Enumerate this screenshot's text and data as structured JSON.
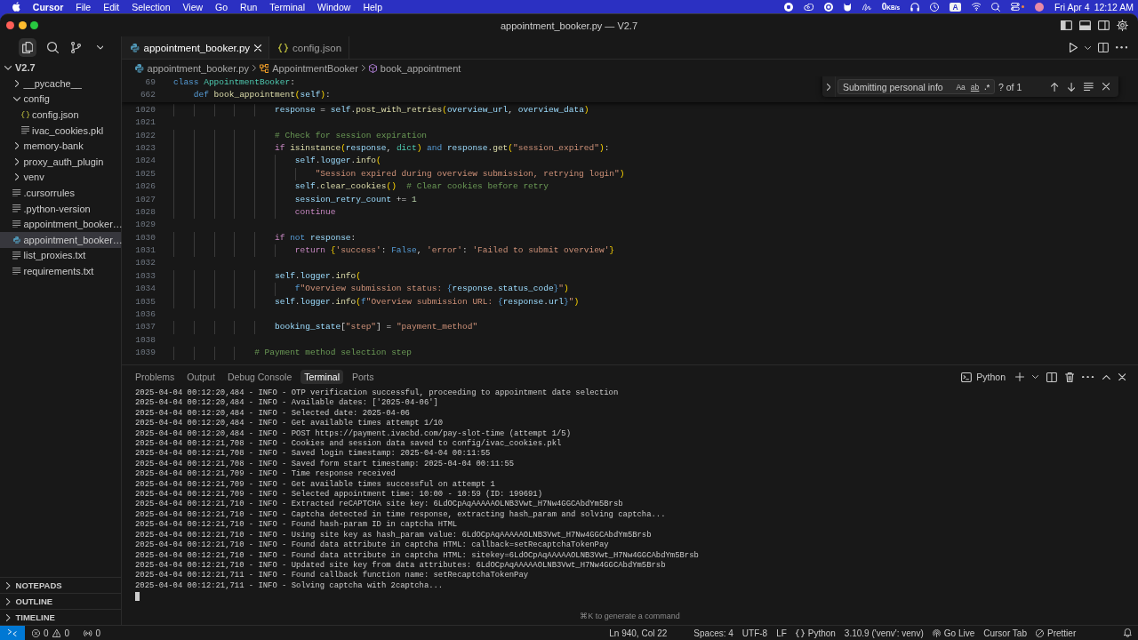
{
  "menu_bar": {
    "app": "Cursor",
    "menus": [
      "File",
      "Edit",
      "Selection",
      "View",
      "Go",
      "Run",
      "Terminal",
      "Window",
      "Help"
    ],
    "network": {
      "value": "0",
      "unit": "KB/s"
    },
    "input_source": "A",
    "date": "Fri Apr 4",
    "time": "12:12 AM"
  },
  "window": {
    "title": "appointment_booker.py — V2.7"
  },
  "activity_bar": [
    {
      "selected": true
    },
    {
      "selected": false
    },
    {
      "selected": false
    }
  ],
  "explorer": {
    "root": {
      "label": "V2.7",
      "kind": "folder",
      "expanded": true,
      "selected": false,
      "children": [
        {
          "label": "__pycache__",
          "kind": "folder",
          "expanded": false,
          "selected": false
        },
        {
          "label": "config",
          "kind": "folder",
          "expanded": true,
          "selected": false,
          "children": [
            {
              "label": "config.json",
              "kind": "json",
              "selected": false
            },
            {
              "label": "ivac_cookies.pkl",
              "kind": "text",
              "selected": false
            }
          ]
        },
        {
          "label": "memory-bank",
          "kind": "folder",
          "expanded": false,
          "selected": false
        },
        {
          "label": "proxy_auth_plugin",
          "kind": "folder",
          "expanded": false,
          "selected": false
        },
        {
          "label": "venv",
          "kind": "folder",
          "expanded": false,
          "selected": false
        },
        {
          "label": ".cursorrules",
          "kind": "text",
          "selected": false
        },
        {
          "label": ".python-version",
          "kind": "text",
          "selected": false
        },
        {
          "label": "appointment_booker…",
          "kind": "text",
          "selected": false
        },
        {
          "label": "appointment_booker…",
          "kind": "python",
          "selected": true
        },
        {
          "label": "list_proxies.txt",
          "kind": "text",
          "selected": false
        },
        {
          "label": "requirements.txt",
          "kind": "text",
          "selected": false
        }
      ]
    }
  },
  "sections": [
    {
      "label": "NOTEPADS",
      "expanded": false
    },
    {
      "label": "OUTLINE",
      "expanded": false
    },
    {
      "label": "TIMELINE",
      "expanded": false
    }
  ],
  "editor_tabs": [
    {
      "label": "appointment_booker.py",
      "kind": "python",
      "selected": true
    },
    {
      "label": "config.json",
      "kind": "json",
      "selected": false
    }
  ],
  "breadcrumbs": [
    {
      "label": "appointment_booker.py",
      "kind": "file"
    },
    {
      "label": "AppointmentBooker",
      "kind": "class"
    },
    {
      "label": "book_appointment",
      "kind": "method"
    }
  ],
  "sticky_lines": [
    {
      "number": "69",
      "tokens": [
        {
          "kind": "kw",
          "text": "class"
        },
        {
          "kind": "cls",
          "text": " AppointmentBooker"
        },
        {
          "kind": "op",
          "text": ":"
        }
      ]
    },
    {
      "number": "662",
      "tokens": [
        {
          "kind": "kw",
          "text": "    def"
        },
        {
          "kind": "fn",
          "text": " book_appointment"
        },
        {
          "kind": "br1",
          "text": "("
        },
        {
          "kind": "var",
          "text": "self"
        },
        {
          "kind": "br1",
          "text": ")"
        },
        {
          "kind": "op",
          "text": ":"
        }
      ]
    }
  ],
  "code_lines": [
    {
      "number": "1020",
      "tokens": [
        {
          "kind": "var",
          "text": "                    response"
        },
        {
          "kind": "op",
          "text": " = "
        },
        {
          "kind": "var",
          "text": "self"
        },
        {
          "kind": "op",
          "text": "."
        },
        {
          "kind": "fn",
          "text": "post_with_retries"
        },
        {
          "kind": "br1",
          "text": "("
        },
        {
          "kind": "var",
          "text": "overview_url"
        },
        {
          "kind": "op",
          "text": ", "
        },
        {
          "kind": "var",
          "text": "overview_data"
        },
        {
          "kind": "br1",
          "text": ")"
        }
      ]
    },
    {
      "number": "1021"
    },
    {
      "number": "1022",
      "tokens": [
        {
          "kind": "cmt",
          "text": "                    # Check for session expiration"
        }
      ]
    },
    {
      "number": "1023",
      "tokens": [
        {
          "kind": "ctrl",
          "text": "                    if"
        },
        {
          "kind": "fn",
          "text": " isinstance"
        },
        {
          "kind": "br1",
          "text": "("
        },
        {
          "kind": "var",
          "text": "response"
        },
        {
          "kind": "op",
          "text": ", "
        },
        {
          "kind": "cls",
          "text": "dict"
        },
        {
          "kind": "br1",
          "text": ")"
        },
        {
          "kind": "kw",
          "text": " and"
        },
        {
          "kind": "var",
          "text": " response"
        },
        {
          "kind": "op",
          "text": "."
        },
        {
          "kind": "fn",
          "text": "get"
        },
        {
          "kind": "br1",
          "text": "("
        },
        {
          "kind": "str",
          "text": "\"session_expired\""
        },
        {
          "kind": "br1",
          "text": ")"
        },
        {
          "kind": "op",
          "text": ":"
        }
      ]
    },
    {
      "number": "1024",
      "tokens": [
        {
          "kind": "var",
          "text": "                        self"
        },
        {
          "kind": "op",
          "text": "."
        },
        {
          "kind": "var",
          "text": "logger"
        },
        {
          "kind": "op",
          "text": "."
        },
        {
          "kind": "fn",
          "text": "info"
        },
        {
          "kind": "br1",
          "text": "("
        }
      ]
    },
    {
      "number": "1025",
      "tokens": [
        {
          "kind": "str",
          "text": "                            \"Session expired during overview submission, retrying login\""
        },
        {
          "kind": "br1",
          "text": ")"
        }
      ]
    },
    {
      "number": "1026",
      "tokens": [
        {
          "kind": "var",
          "text": "                        self"
        },
        {
          "kind": "op",
          "text": "."
        },
        {
          "kind": "fn",
          "text": "clear_cookies"
        },
        {
          "kind": "br1",
          "text": "()"
        },
        {
          "kind": "cmt",
          "text": "  # Clear cookies before retry"
        }
      ]
    },
    {
      "number": "1027",
      "tokens": [
        {
          "kind": "var",
          "text": "                        session_retry_count"
        },
        {
          "kind": "op",
          "text": " += "
        },
        {
          "kind": "num",
          "text": "1"
        }
      ]
    },
    {
      "number": "1028",
      "tokens": [
        {
          "kind": "ctrl",
          "text": "                        continue"
        }
      ]
    },
    {
      "number": "1029"
    },
    {
      "number": "1030",
      "tokens": [
        {
          "kind": "ctrl",
          "text": "                    if"
        },
        {
          "kind": "kw",
          "text": " not"
        },
        {
          "kind": "var",
          "text": " response"
        },
        {
          "kind": "op",
          "text": ":"
        }
      ]
    },
    {
      "number": "1031",
      "tokens": [
        {
          "kind": "ctrl",
          "text": "                        return"
        },
        {
          "kind": "br1",
          "text": " {"
        },
        {
          "kind": "str",
          "text": "'success'"
        },
        {
          "kind": "op",
          "text": ": "
        },
        {
          "kind": "kw",
          "text": "False"
        },
        {
          "kind": "op",
          "text": ", "
        },
        {
          "kind": "str",
          "text": "'error'"
        },
        {
          "kind": "op",
          "text": ": "
        },
        {
          "kind": "str",
          "text": "'Failed to submit overview'"
        },
        {
          "kind": "br1",
          "text": "}"
        }
      ]
    },
    {
      "number": "1032"
    },
    {
      "number": "1033",
      "tokens": [
        {
          "kind": "var",
          "text": "                    self"
        },
        {
          "kind": "op",
          "text": "."
        },
        {
          "kind": "var",
          "text": "logger"
        },
        {
          "kind": "op",
          "text": "."
        },
        {
          "kind": "fn",
          "text": "info"
        },
        {
          "kind": "br1",
          "text": "("
        }
      ]
    },
    {
      "number": "1034",
      "tokens": [
        {
          "kind": "kw",
          "text": "                        f"
        },
        {
          "kind": "str",
          "text": "\"Overview submission status: "
        },
        {
          "kind": "kw",
          "text": "{"
        },
        {
          "kind": "var",
          "text": "response"
        },
        {
          "kind": "op",
          "text": "."
        },
        {
          "kind": "var",
          "text": "status_code"
        },
        {
          "kind": "kw",
          "text": "}"
        },
        {
          "kind": "str",
          "text": "\""
        },
        {
          "kind": "br1",
          "text": ")"
        }
      ]
    },
    {
      "number": "1035",
      "tokens": [
        {
          "kind": "var",
          "text": "                    self"
        },
        {
          "kind": "op",
          "text": "."
        },
        {
          "kind": "var",
          "text": "logger"
        },
        {
          "kind": "op",
          "text": "."
        },
        {
          "kind": "fn",
          "text": "info"
        },
        {
          "kind": "br1",
          "text": "("
        },
        {
          "kind": "kw",
          "text": "f"
        },
        {
          "kind": "str",
          "text": "\"Overview submission URL: "
        },
        {
          "kind": "kw",
          "text": "{"
        },
        {
          "kind": "var",
          "text": "response"
        },
        {
          "kind": "op",
          "text": "."
        },
        {
          "kind": "var",
          "text": "url"
        },
        {
          "kind": "kw",
          "text": "}"
        },
        {
          "kind": "str",
          "text": "\""
        },
        {
          "kind": "br1",
          "text": ")"
        }
      ]
    },
    {
      "number": "1036"
    },
    {
      "number": "1037",
      "tokens": [
        {
          "kind": "var",
          "text": "                    booking_state"
        },
        {
          "kind": "op",
          "text": "["
        },
        {
          "kind": "str",
          "text": "\"step\""
        },
        {
          "kind": "op",
          "text": "] = "
        },
        {
          "kind": "str",
          "text": "\"payment_method\""
        }
      ]
    },
    {
      "number": "1038"
    },
    {
      "number": "1039",
      "tokens": [
        {
          "kind": "cmt",
          "text": "                # Payment method selection step"
        }
      ]
    }
  ],
  "find_widget": {
    "expanded": false,
    "query": "Submitting personal info",
    "options": [
      {
        "label": "Aa",
        "kind": "case"
      },
      {
        "label": "ab",
        "kind": "word"
      },
      {
        "label": ".*",
        "kind": "regex"
      }
    ],
    "result": "? of 1"
  },
  "panel": {
    "tabs": [
      {
        "label": "Problems",
        "selected": false
      },
      {
        "label": "Output",
        "selected": false
      },
      {
        "label": "Debug Console",
        "selected": false
      },
      {
        "label": "Terminal",
        "selected": true
      },
      {
        "label": "Ports",
        "selected": false
      }
    ],
    "terminal_profile": "Python",
    "terminal_lines": [
      "2025-04-04 00:12:20,484 - INFO - OTP verification successful, proceeding to appointment date selection",
      "2025-04-04 00:12:20,484 - INFO - Available dates: ['2025-04-06']",
      "2025-04-04 00:12:20,484 - INFO - Selected date: 2025-04-06",
      "2025-04-04 00:12:20,484 - INFO - Get available times attempt 1/10",
      "2025-04-04 00:12:20,484 - INFO - POST https://payment.ivacbd.com/pay-slot-time (attempt 1/5)",
      "2025-04-04 00:12:21,708 - INFO - Cookies and session data saved to config/ivac_cookies.pkl",
      "2025-04-04 00:12:21,708 - INFO - Saved login timestamp: 2025-04-04 00:11:55",
      "2025-04-04 00:12:21,708 - INFO - Saved form start timestamp: 2025-04-04 00:11:55",
      "2025-04-04 00:12:21,709 - INFO - Time response received",
      "2025-04-04 00:12:21,709 - INFO - Get available times successful on attempt 1",
      "2025-04-04 00:12:21,709 - INFO - Selected appointment time: 10:00 - 10:59 (ID: 199691)",
      "2025-04-04 00:12:21,710 - INFO - Extracted reCAPTCHA site key: 6LdOCpAqAAAAAOLNB3Vwt_H7Nw4GGCAbdYm5Brsb",
      "2025-04-04 00:12:21,710 - INFO - Captcha detected in time response, extracting hash_param and solving captcha...",
      "2025-04-04 00:12:21,710 - INFO - Found hash-param ID in captcha HTML",
      "2025-04-04 00:12:21,710 - INFO - Using site key as hash_param value: 6LdOCpAqAAAAAOLNB3Vwt_H7Nw4GGCAbdYm5Brsb",
      "2025-04-04 00:12:21,710 - INFO - Found data attribute in captcha HTML: callback=setRecaptchaTokenPay",
      "2025-04-04 00:12:21,710 - INFO - Found data attribute in captcha HTML: sitekey=6LdOCpAqAAAAAOLNB3Vwt_H7Nw4GGCAbdYm5Brsb",
      "2025-04-04 00:12:21,710 - INFO - Updated site key from data attributes: 6LdOCpAqAAAAAOLNB3Vwt_H7Nw4GGCAbdYm5Brsb",
      "2025-04-04 00:12:21,711 - INFO - Found callback function name: setRecaptchaTokenPay",
      "2025-04-04 00:12:21,711 - INFO - Solving captcha with 2captcha..."
    ],
    "hint": "⌘K to generate a command"
  },
  "status_bar": {
    "errors": "0",
    "warnings": "0",
    "ports": "0",
    "items": [
      {
        "text": "Ln 940, Col 22",
        "kind": "plain"
      },
      {
        "text": "Spaces: 4",
        "kind": "plain"
      },
      {
        "text": "UTF-8",
        "kind": "plain"
      },
      {
        "text": "LF",
        "kind": "plain"
      },
      {
        "text": "Python",
        "kind": "language"
      },
      {
        "text": "3.10.9 ('venv': venv)",
        "kind": "plain"
      },
      {
        "text": "Go Live",
        "kind": "live"
      },
      {
        "text": "Cursor Tab",
        "kind": "plain"
      },
      {
        "text": "Prettier",
        "kind": "prettier"
      }
    ]
  }
}
